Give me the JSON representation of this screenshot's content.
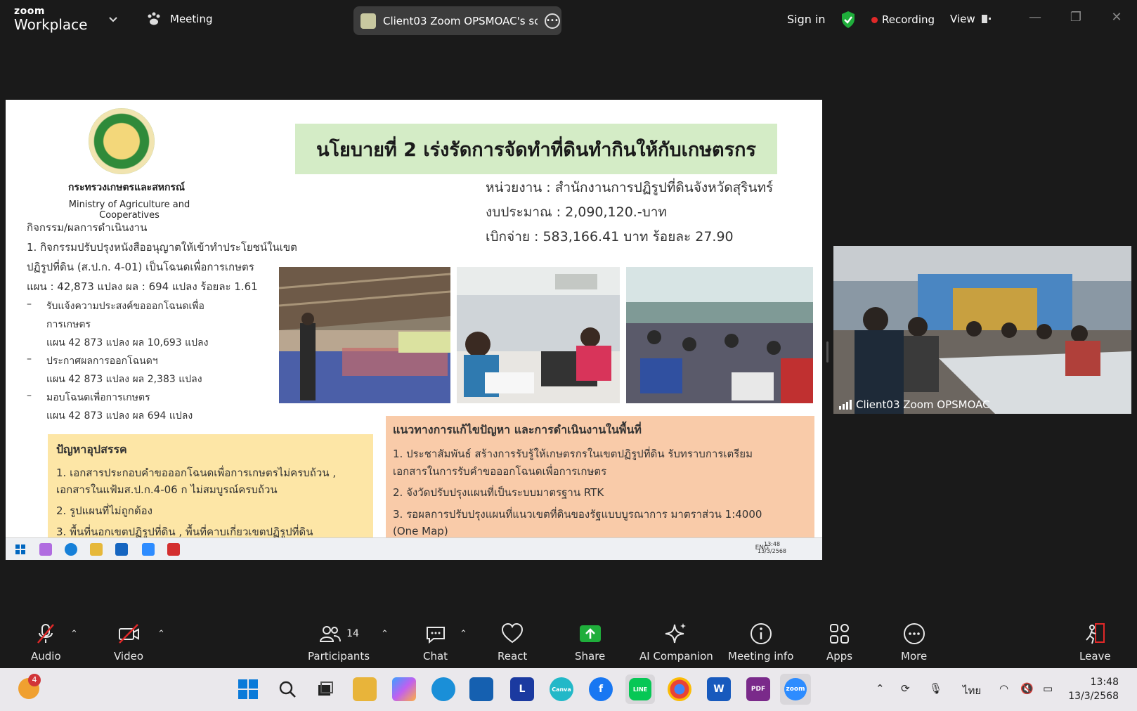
{
  "titlebar": {
    "brand_small": "zoom",
    "brand_large": "Workplace",
    "meeting_label": "Meeting",
    "share_title": "Client03 Zoom OPSMOAC's scre",
    "sign_in": "Sign in",
    "recording": "Recording",
    "view": "View",
    "colors": {
      "background": "#1a1a1a",
      "recording_dot": "#e02828",
      "shield": "#1fae3b"
    }
  },
  "slide": {
    "ministry_th": "กระทรวงเกษตรและสหกรณ์",
    "ministry_en": "Ministry of Agriculture and Cooperatives",
    "banner": "นโยบายที่ 2 เร่งรัดการจัดทำที่ดินทำกินให้กับเกษตรกร",
    "agency": "หน่วยงาน : สำนักงานการปฏิรูปที่ดินจังหวัดสุรินทร์",
    "budget": "งบประมาณ : 2,090,120.-บาท",
    "spent": "เบิกจ่าย : 583,166.41 บาท  ร้อยละ 27.90",
    "activity_title": "กิจกรรม/ผลการดำเนินงาน",
    "activity_1a": "1. กิจกรรมปรับปรุงหนังสืออนุญาตให้เข้าทำประโยชน์ในเขต",
    "activity_1b": "ปฏิรูปที่ดิน (ส.ป.ก. 4-01) เป็นโฉนดเพื่อการเกษตร",
    "activity_1c": "แผน : 42,873 แปลง ผล :  694 แปลง ร้อยละ 1.61",
    "sub1a": "รับแจ้งความประสงค์ขอออกโฉนดเพื่อ",
    "sub1b": "การเกษตร",
    "sub1c": "แผน 42 873 แปลง ผล 10,693 แปลง",
    "sub2a": "ประกาศผลการออกโฉนดฯ",
    "sub2c": "แผน 42 873 แปลง ผล 2,383 แปลง",
    "sub3a": "มอบโฉนดเพื่อการเกษตร",
    "sub3c": "แผน 42 873 แปลง ผล 694 แปลง",
    "dash": "–",
    "problems_title": "ปัญหาอุปสรรค",
    "problem_1": "1.   เอกสารประกอบคำขอออกโฉนดเพื่อการเกษตรไม่ครบถ้วน ,",
    "problem_1b": "      เอกสารในแฟ้มส.ป.ก.4-06 ก ไม่สมบูรณ์ครบถ้วน",
    "problem_2": "2.  รูปแผนที่ไม่ถูกต้อง",
    "problem_3": "3.  พื้นที่นอกเขตปฏิรูปที่ดิน , พื้นที่คาบเกี่ยวเขตปฏิรูปที่ดิน",
    "solutions_title": "แนวทางการแก้ไขปัญหา และการดำเนินงานในพื้นที่",
    "solution_1": "1. ประชาสัมพันธ์ สร้างการรับรู้ให้เกษตรกรในเขตปฏิรูปที่ดิน รับทราบการเตรียม",
    "solution_1b": "    เอกสารในการรับคำขอออกโฉนดเพื่อการเกษตร",
    "solution_2": "2. จังวัดปรับปรุงแผนที่เป็นระบบมาตรฐาน RTK",
    "solution_3": "3. รอผลการปรับปรุงแผนที่แนวเขตที่ดินของรัฐแบบบูรณาการ มาตราส่วน 1:4000",
    "solution_3b": "    (One Map)",
    "inner_tray": "ENG",
    "inner_time": "13:48",
    "inner_date": "13/3/2568",
    "colors": {
      "banner": "#d4ecc6",
      "problems": "#fde6a6",
      "solutions": "#f9cba9"
    }
  },
  "video": {
    "participant_name": "Client03 Zoom OPSMOAC"
  },
  "controls": {
    "audio": "Audio",
    "video": "Video",
    "participants": "Participants",
    "participant_count": "14",
    "chat": "Chat",
    "react": "React",
    "share": "Share",
    "ai_companion": "AI Companion",
    "meeting_info": "Meeting info",
    "apps": "Apps",
    "more": "More",
    "leave": "Leave",
    "colors": {
      "muted": "#e02828",
      "share": "#1fae3b"
    }
  },
  "taskbar": {
    "notification_count": "4",
    "lang": "ไทย",
    "time": "13:48",
    "date": "13/3/2568",
    "app_L": "L",
    "app_canva": "Canva",
    "app_line": "LINE",
    "app_word": "W",
    "app_zoom": "zoom",
    "app_pdf": "PDF"
  }
}
